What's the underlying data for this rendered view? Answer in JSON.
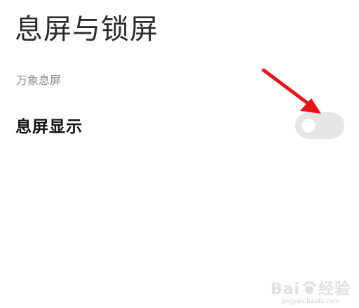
{
  "header": {
    "title": "息屏与锁屏"
  },
  "section": {
    "label": "万象息屏"
  },
  "settings": [
    {
      "label": "息屏显示",
      "toggle_on": false
    }
  ],
  "annotation": {
    "arrow_color": "#e8141c",
    "icon": "arrow-pointer-icon"
  },
  "watermark": {
    "brand": "Bai",
    "brand_tail": "经验",
    "url": "jingyan.baidu.com"
  },
  "colors": {
    "toggle_off_track": "#e6e6e6",
    "toggle_knob": "#ffffff",
    "section_label": "#8e8e8e"
  }
}
